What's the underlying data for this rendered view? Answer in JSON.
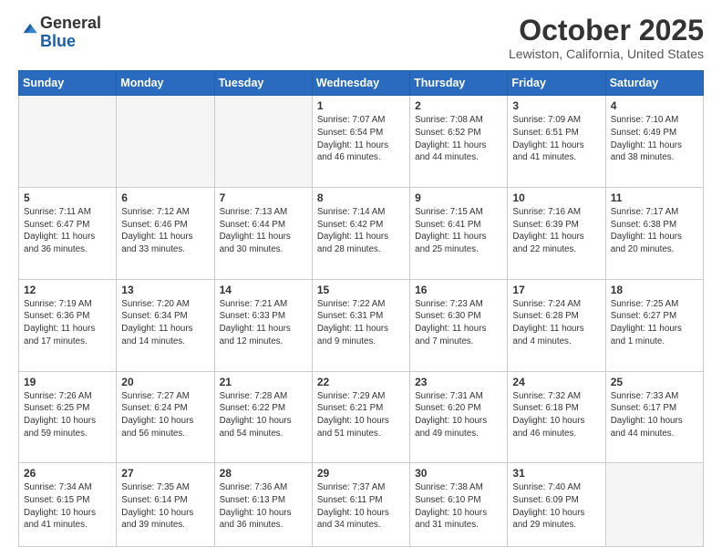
{
  "header": {
    "logo_general": "General",
    "logo_blue": "Blue",
    "month": "October 2025",
    "location": "Lewiston, California, United States"
  },
  "days_of_week": [
    "Sunday",
    "Monday",
    "Tuesday",
    "Wednesday",
    "Thursday",
    "Friday",
    "Saturday"
  ],
  "weeks": [
    [
      {
        "day": "",
        "info": ""
      },
      {
        "day": "",
        "info": ""
      },
      {
        "day": "",
        "info": ""
      },
      {
        "day": "1",
        "info": "Sunrise: 7:07 AM\nSunset: 6:54 PM\nDaylight: 11 hours and 46 minutes."
      },
      {
        "day": "2",
        "info": "Sunrise: 7:08 AM\nSunset: 6:52 PM\nDaylight: 11 hours and 44 minutes."
      },
      {
        "day": "3",
        "info": "Sunrise: 7:09 AM\nSunset: 6:51 PM\nDaylight: 11 hours and 41 minutes."
      },
      {
        "day": "4",
        "info": "Sunrise: 7:10 AM\nSunset: 6:49 PM\nDaylight: 11 hours and 38 minutes."
      }
    ],
    [
      {
        "day": "5",
        "info": "Sunrise: 7:11 AM\nSunset: 6:47 PM\nDaylight: 11 hours and 36 minutes."
      },
      {
        "day": "6",
        "info": "Sunrise: 7:12 AM\nSunset: 6:46 PM\nDaylight: 11 hours and 33 minutes."
      },
      {
        "day": "7",
        "info": "Sunrise: 7:13 AM\nSunset: 6:44 PM\nDaylight: 11 hours and 30 minutes."
      },
      {
        "day": "8",
        "info": "Sunrise: 7:14 AM\nSunset: 6:42 PM\nDaylight: 11 hours and 28 minutes."
      },
      {
        "day": "9",
        "info": "Sunrise: 7:15 AM\nSunset: 6:41 PM\nDaylight: 11 hours and 25 minutes."
      },
      {
        "day": "10",
        "info": "Sunrise: 7:16 AM\nSunset: 6:39 PM\nDaylight: 11 hours and 22 minutes."
      },
      {
        "day": "11",
        "info": "Sunrise: 7:17 AM\nSunset: 6:38 PM\nDaylight: 11 hours and 20 minutes."
      }
    ],
    [
      {
        "day": "12",
        "info": "Sunrise: 7:19 AM\nSunset: 6:36 PM\nDaylight: 11 hours and 17 minutes."
      },
      {
        "day": "13",
        "info": "Sunrise: 7:20 AM\nSunset: 6:34 PM\nDaylight: 11 hours and 14 minutes."
      },
      {
        "day": "14",
        "info": "Sunrise: 7:21 AM\nSunset: 6:33 PM\nDaylight: 11 hours and 12 minutes."
      },
      {
        "day": "15",
        "info": "Sunrise: 7:22 AM\nSunset: 6:31 PM\nDaylight: 11 hours and 9 minutes."
      },
      {
        "day": "16",
        "info": "Sunrise: 7:23 AM\nSunset: 6:30 PM\nDaylight: 11 hours and 7 minutes."
      },
      {
        "day": "17",
        "info": "Sunrise: 7:24 AM\nSunset: 6:28 PM\nDaylight: 11 hours and 4 minutes."
      },
      {
        "day": "18",
        "info": "Sunrise: 7:25 AM\nSunset: 6:27 PM\nDaylight: 11 hours and 1 minute."
      }
    ],
    [
      {
        "day": "19",
        "info": "Sunrise: 7:26 AM\nSunset: 6:25 PM\nDaylight: 10 hours and 59 minutes."
      },
      {
        "day": "20",
        "info": "Sunrise: 7:27 AM\nSunset: 6:24 PM\nDaylight: 10 hours and 56 minutes."
      },
      {
        "day": "21",
        "info": "Sunrise: 7:28 AM\nSunset: 6:22 PM\nDaylight: 10 hours and 54 minutes."
      },
      {
        "day": "22",
        "info": "Sunrise: 7:29 AM\nSunset: 6:21 PM\nDaylight: 10 hours and 51 minutes."
      },
      {
        "day": "23",
        "info": "Sunrise: 7:31 AM\nSunset: 6:20 PM\nDaylight: 10 hours and 49 minutes."
      },
      {
        "day": "24",
        "info": "Sunrise: 7:32 AM\nSunset: 6:18 PM\nDaylight: 10 hours and 46 minutes."
      },
      {
        "day": "25",
        "info": "Sunrise: 7:33 AM\nSunset: 6:17 PM\nDaylight: 10 hours and 44 minutes."
      }
    ],
    [
      {
        "day": "26",
        "info": "Sunrise: 7:34 AM\nSunset: 6:15 PM\nDaylight: 10 hours and 41 minutes."
      },
      {
        "day": "27",
        "info": "Sunrise: 7:35 AM\nSunset: 6:14 PM\nDaylight: 10 hours and 39 minutes."
      },
      {
        "day": "28",
        "info": "Sunrise: 7:36 AM\nSunset: 6:13 PM\nDaylight: 10 hours and 36 minutes."
      },
      {
        "day": "29",
        "info": "Sunrise: 7:37 AM\nSunset: 6:11 PM\nDaylight: 10 hours and 34 minutes."
      },
      {
        "day": "30",
        "info": "Sunrise: 7:38 AM\nSunset: 6:10 PM\nDaylight: 10 hours and 31 minutes."
      },
      {
        "day": "31",
        "info": "Sunrise: 7:40 AM\nSunset: 6:09 PM\nDaylight: 10 hours and 29 minutes."
      },
      {
        "day": "",
        "info": ""
      }
    ]
  ]
}
